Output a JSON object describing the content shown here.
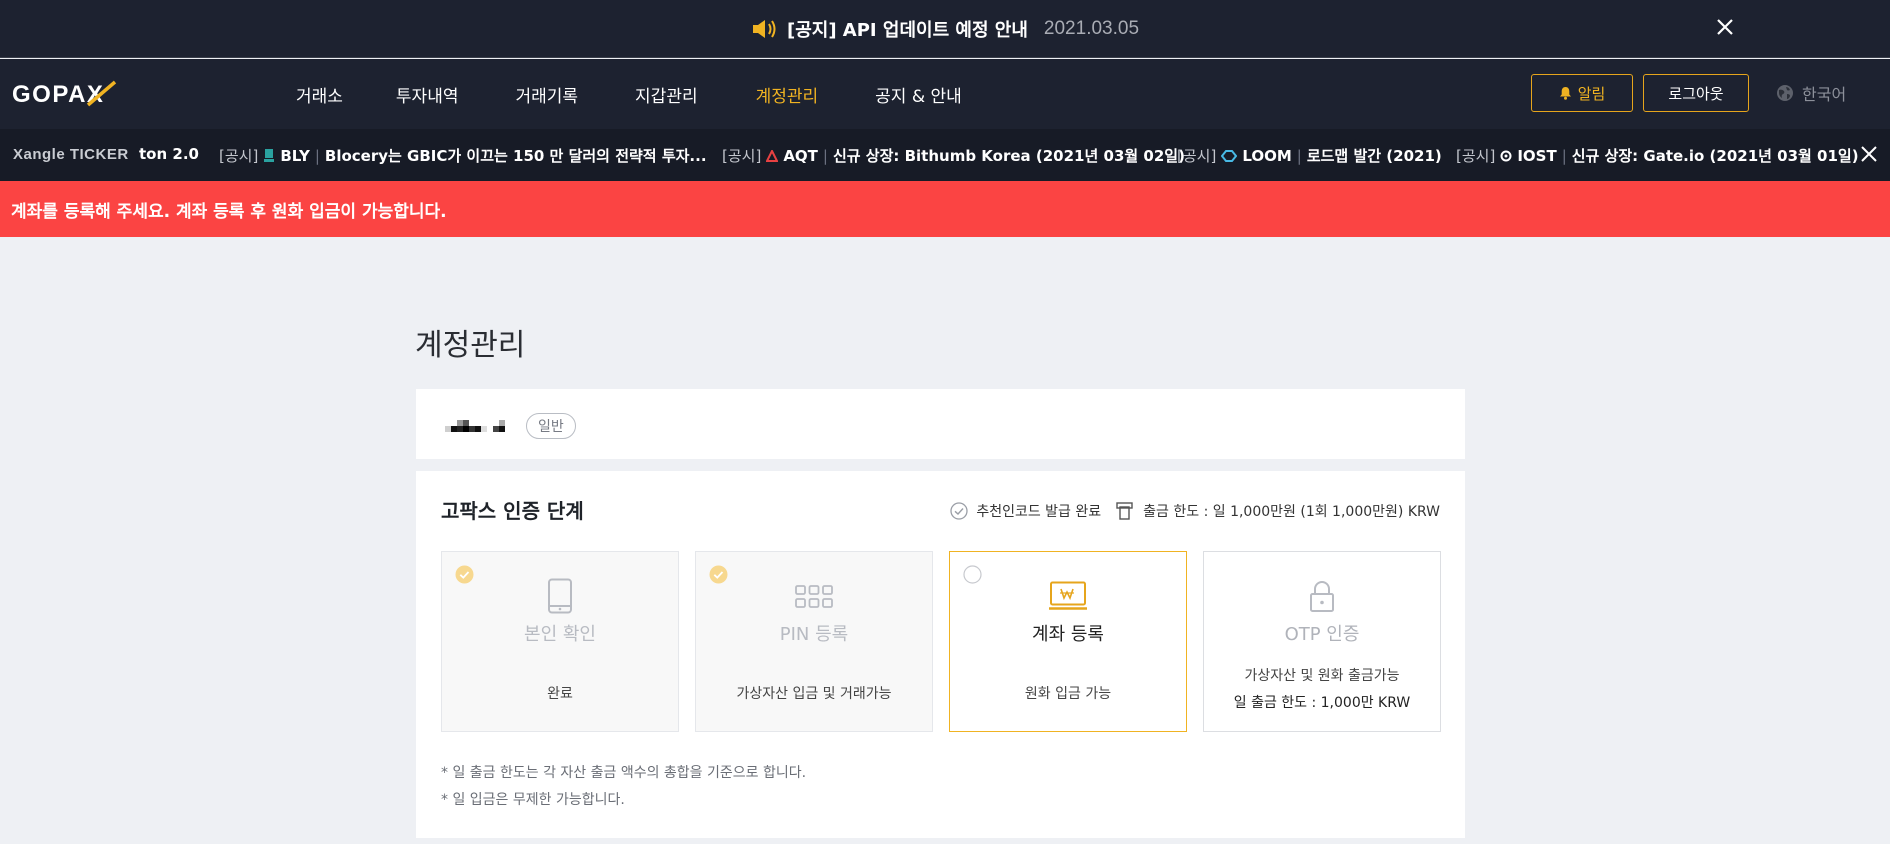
{
  "notice": {
    "text": "[공지] API 업데이트 예정 안내",
    "date": "2021.03.05"
  },
  "header": {
    "logo": "GOPAX",
    "nav": [
      "거래소",
      "투자내역",
      "거래기록",
      "지갑관리",
      "계정관리",
      "공지 & 안내"
    ],
    "active_nav": "계정관리",
    "alarm_label": "알림",
    "logout_label": "로그아웃",
    "language": "한국어"
  },
  "ticker": {
    "brand": "Xangle TICKER",
    "leading_fragment": "ton 2.0",
    "items": [
      {
        "tag": "[공시]",
        "symbol": "BLY",
        "text": "Blocery는 GBIC가 이끄는 150 만 달러의 전략적 투자..."
      },
      {
        "tag": "[공시]",
        "symbol": "AQT",
        "text": "신규 상장: Bithumb Korea (2021년 03월 02일)"
      },
      {
        "tag": "[공시]",
        "symbol": "LOOM",
        "text": "로드맵 발간 (2021)"
      },
      {
        "tag": "[공시]",
        "symbol": "IOST",
        "text": "신규 상장: Gate.io (2021년 03월 01일)"
      }
    ]
  },
  "alert": {
    "text": "계좌를 등록해 주세요. 계좌 등록 후 원화 입금이 가능합니다."
  },
  "page": {
    "title": "계정관리"
  },
  "user": {
    "badge": "일반"
  },
  "verification": {
    "title": "고팍스 인증 단계",
    "referral": "추천인코드 발급 완료",
    "limit": "출금 한도 : 일 1,000만원 (1회 1,000만원) KRW",
    "steps": [
      {
        "name": "본인 확인",
        "desc": "완료",
        "icon": "phone-icon",
        "status": "done"
      },
      {
        "name": "PIN 등록",
        "desc": "가상자산 입금 및 거래가능",
        "icon": "keypad-icon",
        "status": "done"
      },
      {
        "name": "계좌 등록",
        "desc": "원화 입금 가능",
        "icon": "bank-account-icon",
        "status": "current"
      },
      {
        "name": "OTP 인증",
        "desc": "가상자산 및 원화 출금가능",
        "desc2": "일 출금 한도 : 1,000만 KRW",
        "icon": "lock-icon",
        "status": "locked"
      }
    ],
    "notes": [
      "* 일 출금 한도는 각 자산 출금 액수의 총합을 기준으로 합니다.",
      "* 일 입금은 무제한 가능합니다."
    ]
  },
  "colors": {
    "accent": "#f0b322",
    "header_bg": "#1d2230",
    "alert_bg": "#fb4443"
  }
}
